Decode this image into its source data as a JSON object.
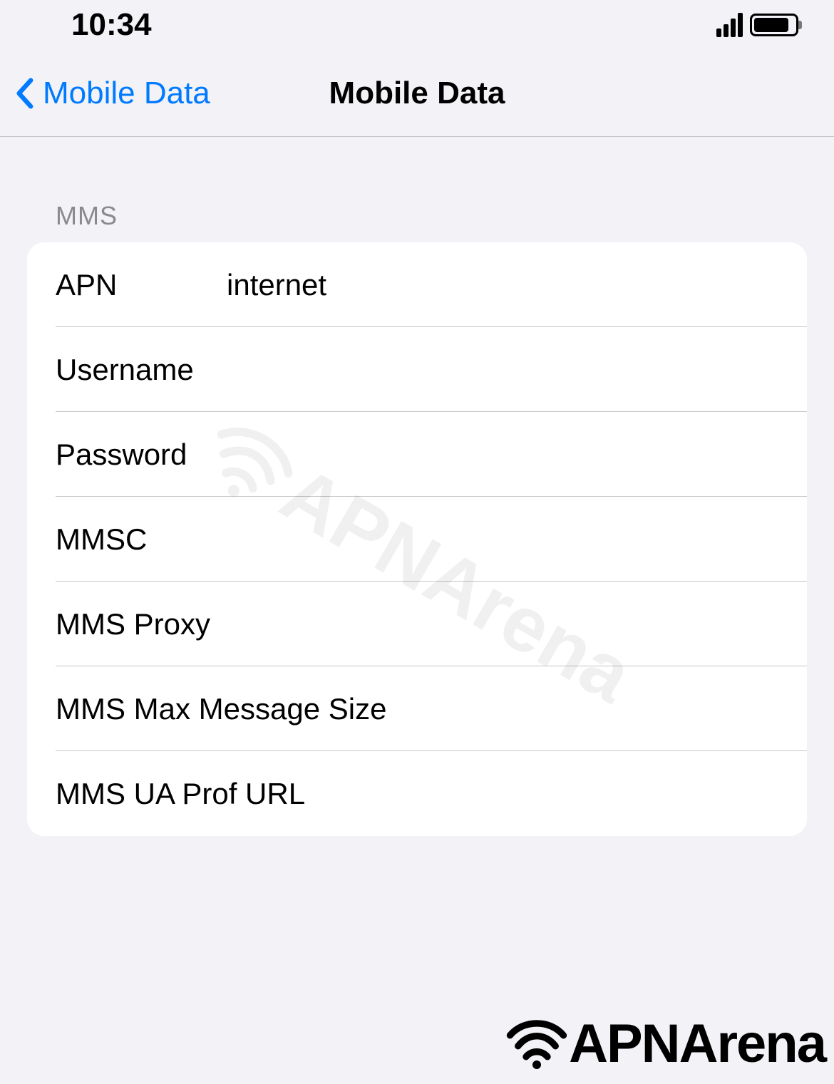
{
  "status": {
    "time": "10:34"
  },
  "nav": {
    "back_label": "Mobile Data",
    "title": "Mobile Data"
  },
  "section": {
    "header": "MMS",
    "rows": {
      "apn": {
        "label": "APN",
        "value": "internet"
      },
      "username": {
        "label": "Username",
        "value": ""
      },
      "password": {
        "label": "Password",
        "value": ""
      },
      "mmsc": {
        "label": "MMSC",
        "value": ""
      },
      "mms_proxy": {
        "label": "MMS Proxy",
        "value": ""
      },
      "mms_max": {
        "label": "MMS Max Message Size",
        "value": ""
      },
      "mms_uaprof": {
        "label": "MMS UA Prof URL",
        "value": ""
      }
    }
  },
  "branding": {
    "watermark": "APNArena",
    "bottom_logo": "APNArena"
  }
}
